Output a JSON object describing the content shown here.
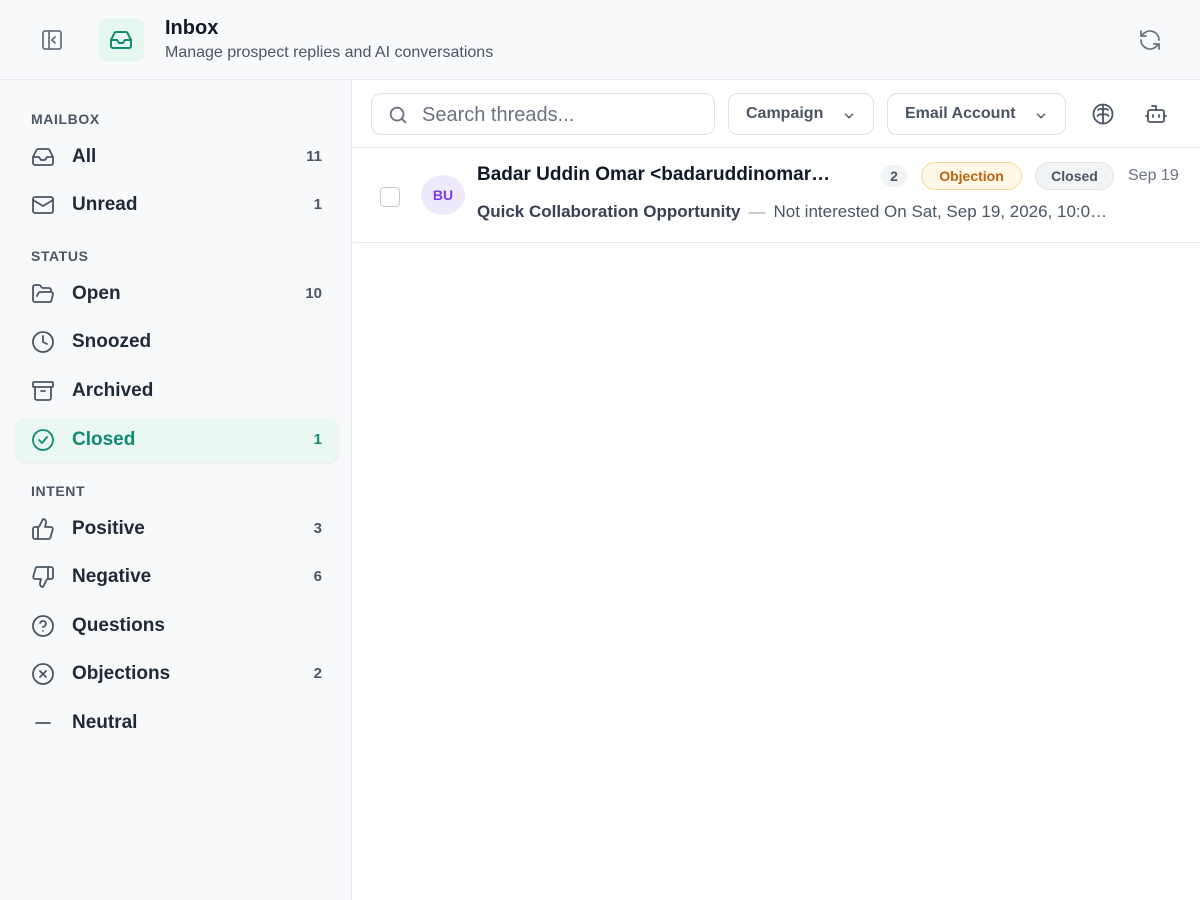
{
  "header": {
    "title": "Inbox",
    "subtitle": "Manage prospect replies and AI conversations"
  },
  "sidebar": {
    "mailbox_heading": "MAILBOX",
    "mailbox": [
      {
        "label": "All",
        "count": "11",
        "icon": "inbox-icon"
      },
      {
        "label": "Unread",
        "count": "1",
        "icon": "mail-icon"
      }
    ],
    "status_heading": "STATUS",
    "status": [
      {
        "label": "Open",
        "count": "10",
        "icon": "folder-open-icon"
      },
      {
        "label": "Snoozed",
        "count": "",
        "icon": "clock-icon"
      },
      {
        "label": "Archived",
        "count": "",
        "icon": "archive-icon"
      },
      {
        "label": "Closed",
        "count": "1",
        "icon": "check-circle-icon",
        "active": true
      }
    ],
    "intent_heading": "INTENT",
    "intent": [
      {
        "label": "Positive",
        "count": "3",
        "icon": "thumbs-up-icon"
      },
      {
        "label": "Negative",
        "count": "6",
        "icon": "thumbs-down-icon"
      },
      {
        "label": "Questions",
        "count": "",
        "icon": "question-circle-icon"
      },
      {
        "label": "Objections",
        "count": "2",
        "icon": "x-circle-icon"
      },
      {
        "label": "Neutral",
        "count": "",
        "icon": "minus-icon"
      }
    ]
  },
  "toolbar": {
    "search_placeholder": "Search threads...",
    "campaign_label": "Campaign",
    "email_account_label": "Email Account"
  },
  "threads": [
    {
      "avatar": "BU",
      "sender": "Badar Uddin Omar <badaruddinomar…",
      "count": "2",
      "intent": "Objection",
      "status": "Closed",
      "date": "Sep 19",
      "subject": "Quick Collaboration Opportunity",
      "separator": "—",
      "snippet": "Not interested On Sat, Sep 19, 2026, 10:0…"
    }
  ],
  "colors": {
    "accent": "#0f8b6f",
    "accent_bg": "#eaf7f3",
    "objection_text": "#c2600a",
    "objection_bg": "#fff8e6",
    "avatar_text": "#7e3af2",
    "avatar_bg": "#efe9fd"
  }
}
